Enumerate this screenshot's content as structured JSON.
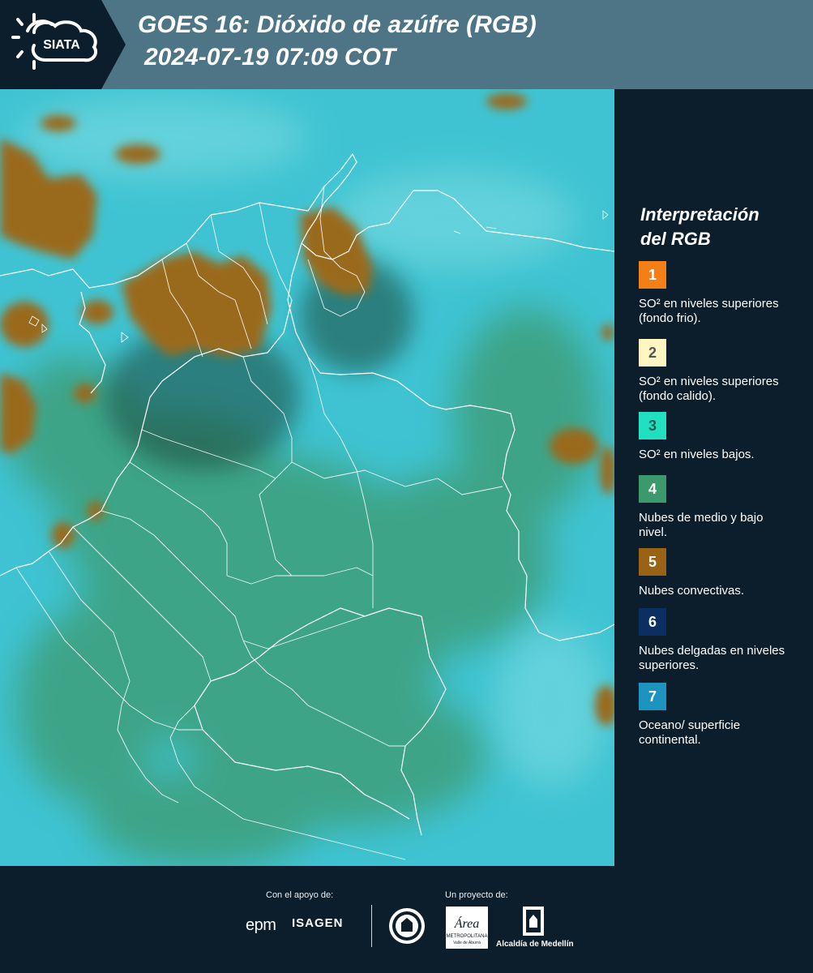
{
  "header": {
    "logo_text": "SIATA",
    "title": "GOES 16: Dióxido de azúfre (RGB)",
    "datetime": "2024-07-19 07:09 COT",
    "band_color": "#4e7585",
    "dark_color": "#0c1e2b"
  },
  "map": {
    "base_color": "#3fc3d2",
    "convective_color": "#9a6b1f",
    "midlevel_color": "#3d9a6e",
    "border_color": "#ffffff"
  },
  "legend": {
    "title_line1": "Interpretación",
    "title_line2": "del RGB",
    "items": [
      {
        "number": "1",
        "color": "#f57f17",
        "text_color": "#ffffff",
        "description": "SO² en niveles superiores (fondo frio)."
      },
      {
        "number": "2",
        "color": "#fff6c2",
        "text_color": "#555555",
        "description": "SO² en niveles superiores (fondo calido)."
      },
      {
        "number": "3",
        "color": "#20e0c0",
        "text_color": "#1b5e58",
        "description": "SO² en niveles bajos."
      },
      {
        "number": "4",
        "color": "#3a9a6c",
        "text_color": "#ffffff",
        "description": "Nubes de medio y bajo nivel."
      },
      {
        "number": "5",
        "color": "#9a6214",
        "text_color": "#ffffff",
        "description": "Nubes convectivas."
      },
      {
        "number": "6",
        "color": "#0c2f63",
        "text_color": "#ffffff",
        "description": "Nubes delgadas en niveles superiores."
      },
      {
        "number": "7",
        "color": "#1d93c0",
        "text_color": "#ffffff",
        "description": "Oceano/ superficie continental."
      }
    ]
  },
  "footer": {
    "support_label": "Con el apoyo de:",
    "project_label": "Un proyecto de:",
    "sponsor1": "epm",
    "sponsor2": "ISAGEN",
    "org_area": "Área",
    "org_area_sub": "METROPOLITANA",
    "org_area_sub2": "Valle de Aburrá",
    "org_alcaldia": "Alcaldía de Medellín"
  }
}
